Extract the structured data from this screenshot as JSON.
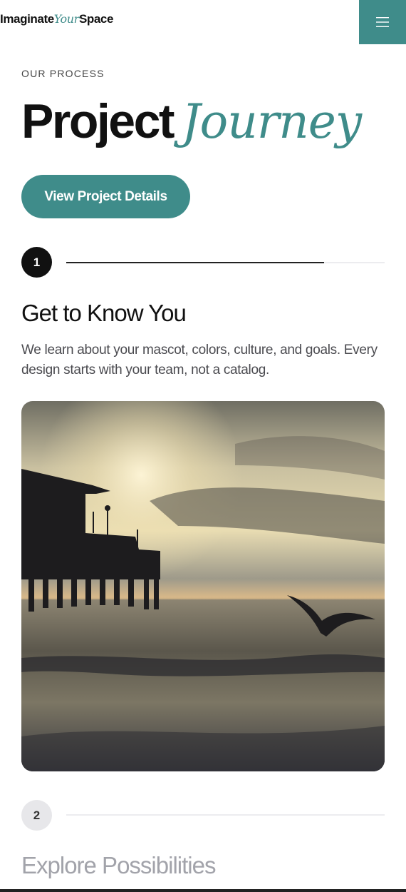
{
  "header": {
    "logo_part1": "Imaginate",
    "logo_part2": "Your",
    "logo_part3": "Space",
    "menu_icon": "hamburger-icon"
  },
  "hero": {
    "eyebrow": "OUR PROCESS",
    "title_bold": "Project",
    "title_script": "Journey",
    "cta_label": "View Project Details"
  },
  "steps": [
    {
      "number": "1",
      "title": "Get to Know You",
      "description": "We learn about your mascot, colors, culture, and goals. Every design starts with your team, not a catalog.",
      "progress": 0.81,
      "active": true
    },
    {
      "number": "2",
      "title": "Explore Possibilities",
      "progress": 0,
      "active": false
    }
  ],
  "colors": {
    "accent": "#3f8c8a",
    "text": "#111111",
    "muted": "#a2a3aa"
  }
}
